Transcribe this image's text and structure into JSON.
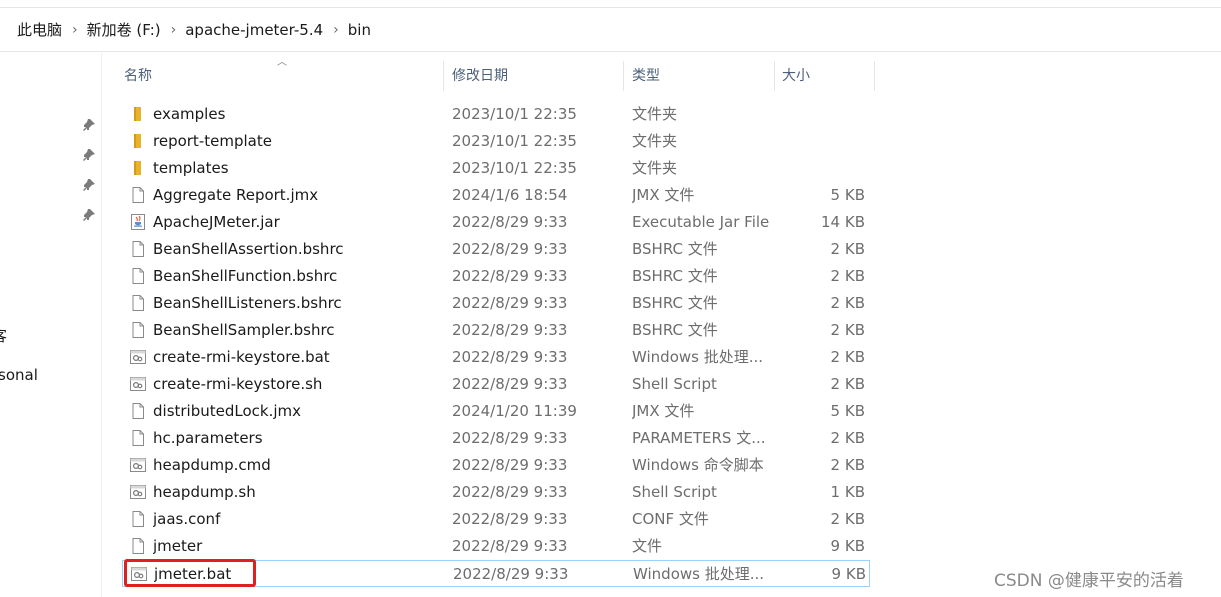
{
  "breadcrumb": [
    "此电脑",
    "新加卷 (F:)",
    "apache-jmeter-5.4",
    "bin"
  ],
  "nav": {
    "text_1": "客",
    "text_2": "sonal"
  },
  "columns": {
    "name": "名称",
    "date": "修改日期",
    "type": "类型",
    "size": "大小"
  },
  "files": [
    {
      "name": "examples",
      "date": "2023/10/1 22:35",
      "type": "文件夹",
      "size": "",
      "icon": "folder-icon"
    },
    {
      "name": "report-template",
      "date": "2023/10/1 22:35",
      "type": "文件夹",
      "size": "",
      "icon": "folder-icon"
    },
    {
      "name": "templates",
      "date": "2023/10/1 22:35",
      "type": "文件夹",
      "size": "",
      "icon": "folder-icon"
    },
    {
      "name": "Aggregate Report.jmx",
      "date": "2024/1/6 18:54",
      "type": "JMX 文件",
      "size": "5 KB",
      "icon": "file-icon"
    },
    {
      "name": "ApacheJMeter.jar",
      "date": "2022/8/29 9:33",
      "type": "Executable Jar File",
      "size": "14 KB",
      "icon": "jar-icon"
    },
    {
      "name": "BeanShellAssertion.bshrc",
      "date": "2022/8/29 9:33",
      "type": "BSHRC 文件",
      "size": "2 KB",
      "icon": "file-icon"
    },
    {
      "name": "BeanShellFunction.bshrc",
      "date": "2022/8/29 9:33",
      "type": "BSHRC 文件",
      "size": "2 KB",
      "icon": "file-icon"
    },
    {
      "name": "BeanShellListeners.bshrc",
      "date": "2022/8/29 9:33",
      "type": "BSHRC 文件",
      "size": "2 KB",
      "icon": "file-icon"
    },
    {
      "name": "BeanShellSampler.bshrc",
      "date": "2022/8/29 9:33",
      "type": "BSHRC 文件",
      "size": "2 KB",
      "icon": "file-icon"
    },
    {
      "name": "create-rmi-keystore.bat",
      "date": "2022/8/29 9:33",
      "type": "Windows 批处理...",
      "size": "2 KB",
      "icon": "script-icon"
    },
    {
      "name": "create-rmi-keystore.sh",
      "date": "2022/8/29 9:33",
      "type": "Shell Script",
      "size": "2 KB",
      "icon": "script-icon"
    },
    {
      "name": "distributedLock.jmx",
      "date": "2024/1/20 11:39",
      "type": "JMX 文件",
      "size": "5 KB",
      "icon": "file-icon"
    },
    {
      "name": "hc.parameters",
      "date": "2022/8/29 9:33",
      "type": "PARAMETERS 文...",
      "size": "2 KB",
      "icon": "file-icon"
    },
    {
      "name": "heapdump.cmd",
      "date": "2022/8/29 9:33",
      "type": "Windows 命令脚本",
      "size": "2 KB",
      "icon": "script-icon"
    },
    {
      "name": "heapdump.sh",
      "date": "2022/8/29 9:33",
      "type": "Shell Script",
      "size": "1 KB",
      "icon": "script-icon"
    },
    {
      "name": "jaas.conf",
      "date": "2022/8/29 9:33",
      "type": "CONF 文件",
      "size": "2 KB",
      "icon": "file-icon"
    },
    {
      "name": "jmeter",
      "date": "2022/8/29 9:33",
      "type": "文件",
      "size": "9 KB",
      "icon": "file-icon"
    },
    {
      "name": "jmeter.bat",
      "date": "2022/8/29 9:33",
      "type": "Windows 批处理...",
      "size": "9 KB",
      "icon": "script-icon",
      "selected": true
    }
  ],
  "colors": {
    "folder": "#e8b22a",
    "highlight": "#e0201e",
    "selection_border": "#99d1ff"
  },
  "watermark": "CSDN @健康平安的活着"
}
